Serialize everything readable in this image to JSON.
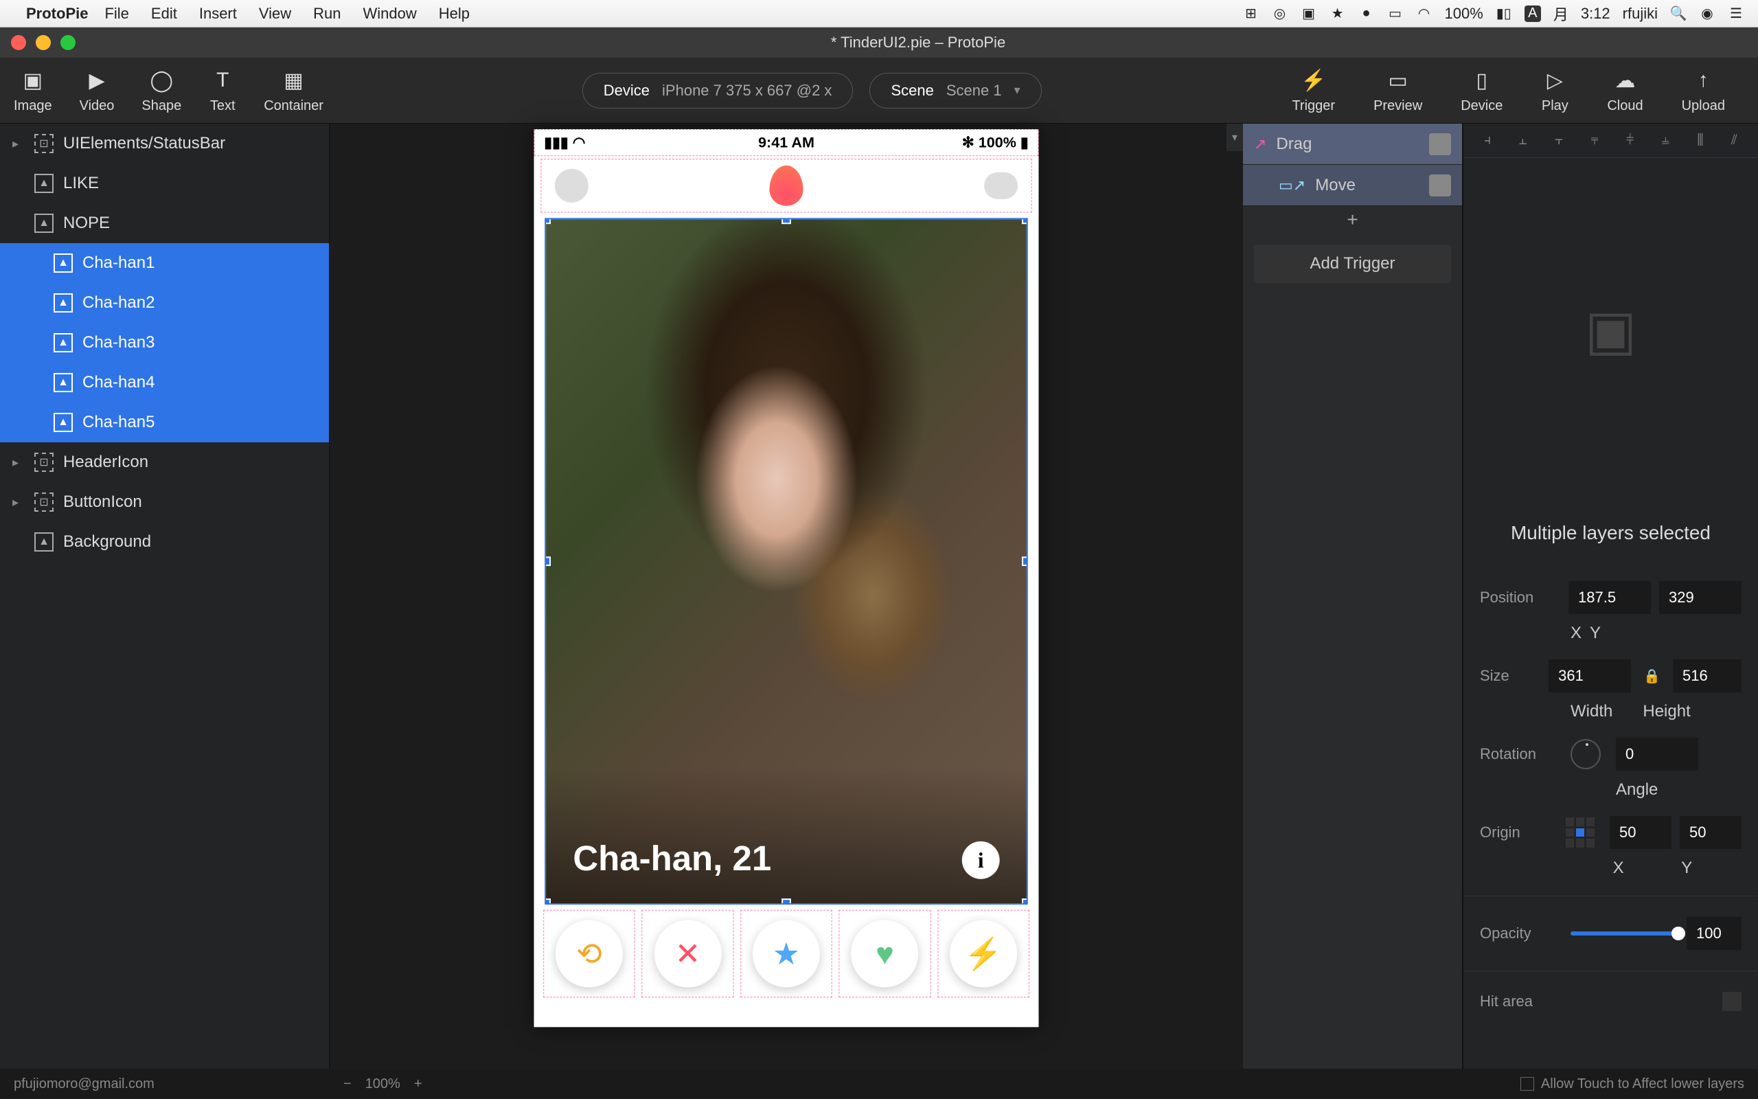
{
  "menubar": {
    "app": "ProtoPie",
    "items": [
      "File",
      "Edit",
      "Insert",
      "View",
      "Run",
      "Window",
      "Help"
    ],
    "battery": "100%",
    "day": "月",
    "time": "3:12",
    "user": "rfujiki"
  },
  "window": {
    "title": "* TinderUI2.pie – ProtoPie"
  },
  "toolbar": {
    "left": [
      {
        "icon": "▣",
        "label": "Image"
      },
      {
        "icon": "▶",
        "label": "Video"
      },
      {
        "icon": "◯",
        "label": "Shape"
      },
      {
        "icon": "T",
        "label": "Text"
      },
      {
        "icon": "▦",
        "label": "Container"
      }
    ],
    "device_label": "Device",
    "device_value": "iPhone 7  375 x 667  @2 x",
    "scene_label": "Scene",
    "scene_value": "Scene 1",
    "right": [
      {
        "icon": "⚡",
        "label": "Trigger"
      },
      {
        "icon": "▭",
        "label": "Preview"
      },
      {
        "icon": "▯",
        "label": "Device"
      },
      {
        "icon": "▷",
        "label": "Play"
      },
      {
        "icon": "☁",
        "label": "Cloud"
      },
      {
        "icon": "↑",
        "label": "Upload"
      }
    ]
  },
  "layers": [
    {
      "name": "UIElements/StatusBar",
      "type": "group",
      "expand": true,
      "indent": false
    },
    {
      "name": "LIKE",
      "type": "image",
      "indent": false
    },
    {
      "name": "NOPE",
      "type": "image",
      "indent": false
    },
    {
      "name": "Cha-han1",
      "type": "image",
      "sel": true,
      "indent": true
    },
    {
      "name": "Cha-han2",
      "type": "image",
      "sel": true,
      "indent": true
    },
    {
      "name": "Cha-han3",
      "type": "image",
      "sel": true,
      "indent": true
    },
    {
      "name": "Cha-han4",
      "type": "image",
      "sel": true,
      "indent": true
    },
    {
      "name": "Cha-han5",
      "type": "image",
      "sel": true,
      "indent": true
    },
    {
      "name": "HeaderIcon",
      "type": "group",
      "expand": true,
      "indent": false
    },
    {
      "name": "ButtonIcon",
      "type": "group",
      "expand": true,
      "indent": false
    },
    {
      "name": "Background",
      "type": "image",
      "indent": false
    }
  ],
  "interactions": {
    "drag": "Drag",
    "move": "Move",
    "add": "+",
    "add_trigger": "Add Trigger"
  },
  "preview": {
    "time": "9:41 AM",
    "battery": "100%",
    "card_name": "Cha-han, 21",
    "info": "i"
  },
  "inspector": {
    "multi": "Multiple layers selected",
    "position_label": "Position",
    "pos_x": "187.5",
    "pos_y": "329",
    "x": "X",
    "y": "Y",
    "size_label": "Size",
    "size_w": "361",
    "size_h": "516",
    "w": "Width",
    "h": "Height",
    "rotation_label": "Rotation",
    "rot": "0",
    "angle": "Angle",
    "origin_label": "Origin",
    "ox": "50",
    "oy": "50",
    "opacity_label": "Opacity",
    "opacity": "100",
    "hitarea_label": "Hit area"
  },
  "footer": {
    "email": "pfujiomoro@gmail.com",
    "zoom": "100%",
    "allow": "Allow Touch to Affect lower layers"
  }
}
